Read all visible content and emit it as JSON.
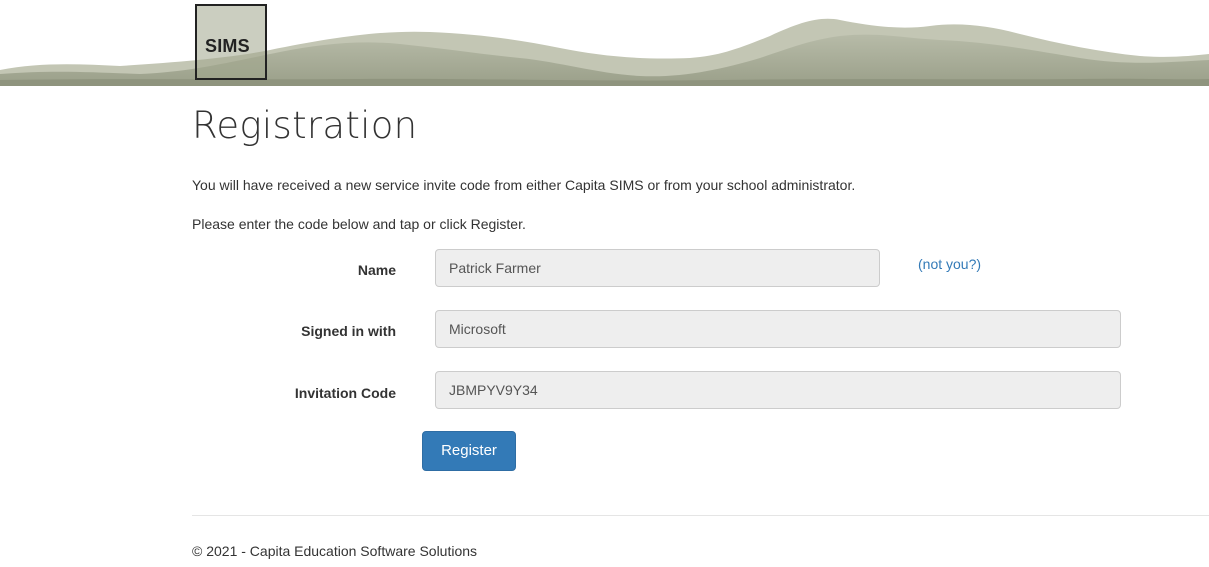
{
  "header": {
    "logo_text": "SIMS"
  },
  "page": {
    "title": "Registration",
    "intro_line_1": "You will have received a new service invite code from either Capita SIMS or from your school administrator.",
    "intro_line_2": "Please enter the code below and tap or click Register."
  },
  "form": {
    "name": {
      "label": "Name",
      "value": "Patrick Farmer",
      "link_text": "(not you?)"
    },
    "signed_in_with": {
      "label": "Signed in with",
      "value": "Microsoft"
    },
    "invitation_code": {
      "label": "Invitation Code",
      "value": "JBMPYV9Y34"
    },
    "submit_label": "Register"
  },
  "footer": {
    "copyright": "© 2021 - Capita Education Software Solutions"
  },
  "colors": {
    "primary_button": "#337ab7",
    "link": "#337ab7",
    "input_background": "#eeeeee",
    "banner_mountains": "#9aa08a"
  }
}
